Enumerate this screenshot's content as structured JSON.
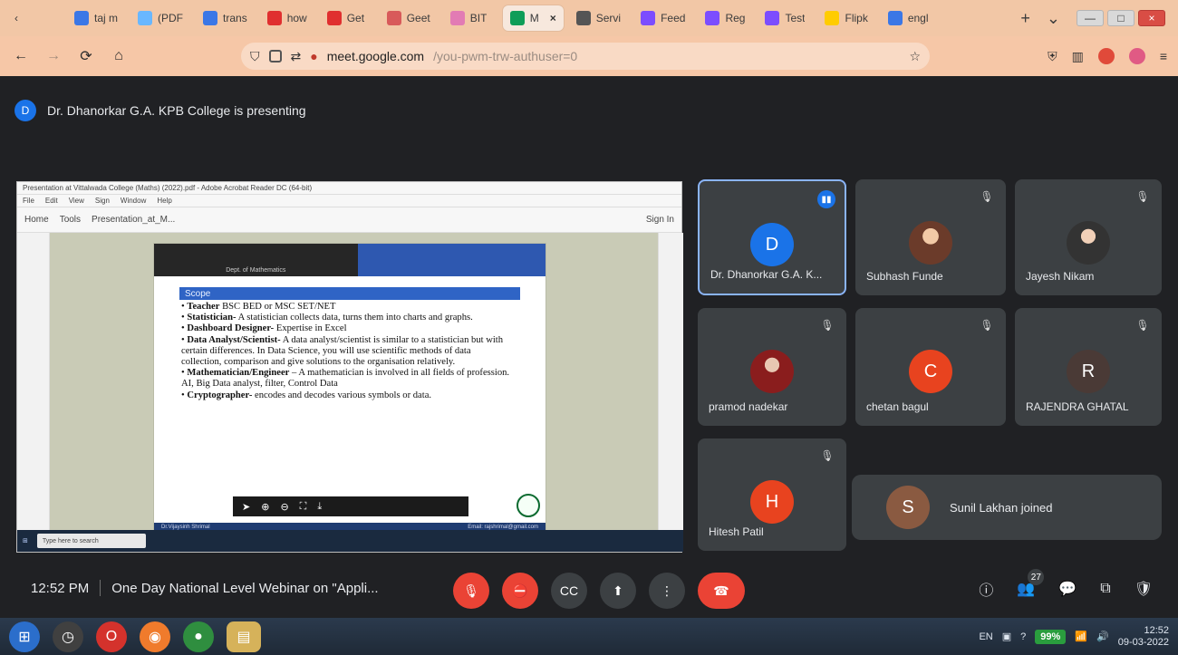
{
  "browser": {
    "tabs": [
      {
        "label": "taj m"
      },
      {
        "label": "(PDF"
      },
      {
        "label": "trans"
      },
      {
        "label": "how"
      },
      {
        "label": "Get"
      },
      {
        "label": "Geet"
      },
      {
        "label": "BIT"
      },
      {
        "label": "M",
        "active": true
      },
      {
        "label": "Servi"
      },
      {
        "label": "Feed"
      },
      {
        "label": "Reg"
      },
      {
        "label": "Test"
      },
      {
        "label": "Flipk"
      },
      {
        "label": "engl"
      }
    ],
    "url_domain": "meet.google.com",
    "url_rest": "/you-pwm-trw-authuser=0"
  },
  "meet": {
    "presenting_badge": "D",
    "presenting_text": "Dr. Dhanorkar G.A. KPB College is presenting",
    "shared_window": {
      "title_bar": "Presentation at Vittalwada College (Maths) (2022).pdf - Adobe Acrobat Reader DC (64-bit)",
      "menu": [
        "File",
        "Edit",
        "View",
        "Sign",
        "Window",
        "Help"
      ],
      "toolbar": [
        "Home",
        "Tools",
        "Presentation_at_M..."
      ],
      "signin": "Sign In",
      "slide": {
        "header_left": "Dept. of Mathematics",
        "scope_label": "Scope",
        "bullets": [
          {
            "bold": "Teacher",
            "rest": " BSC BED or MSC SET/NET"
          },
          {
            "bold": "Statistician-",
            "rest": " A statistician collects data, turns them into charts and graphs."
          },
          {
            "bold": "Dashboard Designer-",
            "rest": " Expertise in Excel"
          },
          {
            "bold": "Data Analyst/Scientist-",
            "rest": " A data analyst/scientist is similar to a statistician but with certain differences. In Data Science, you will use scientific methods of data collection, comparison and give solutions to the organisation relatively."
          },
          {
            "bold": "Mathematician/Engineer",
            "rest": " – A mathematician is involved in all fields of profession. AI, Big Data analyst, filter, Control Data"
          },
          {
            "bold": "Cryptographer-",
            "rest": " encodes and decodes various symbols or data."
          }
        ],
        "footer_left": "Dr.Vijaysinh Shrimal",
        "footer_right": "Email: rajshrimal@gmail.com"
      },
      "taskbar_search": "Type here to search"
    },
    "participants": [
      {
        "name": "Dr. Dhanorkar G.A. K...",
        "initial": "D",
        "avatar_color": "#1a73e8",
        "selected": true
      },
      {
        "name": "Subhash Funde",
        "initial": "",
        "avatar_kind": "photo"
      },
      {
        "name": "Jayesh Nikam",
        "initial": "",
        "avatar_kind": "photo3"
      },
      {
        "name": "pramod nadekar",
        "initial": "",
        "avatar_kind": "photo2"
      },
      {
        "name": "chetan bagul",
        "initial": "C",
        "avatar_color": "#e8431f"
      },
      {
        "name": "RAJENDRA GHATAL",
        "initial": "R",
        "avatar_color": "#4a3a36"
      },
      {
        "name": "Hitesh Patil",
        "initial": "H",
        "avatar_color": "#e8431f"
      }
    ],
    "toast": {
      "initial": "S",
      "text": "Sunil Lakhan joined"
    },
    "bottom": {
      "time": "12:52 PM",
      "meeting_title": "One Day National Level Webinar on \"Appli...",
      "people_count": "27"
    }
  },
  "windows": {
    "taskbar": {
      "lang": "EN",
      "battery": "99%",
      "time": "12:52",
      "date": "09-03-2022"
    }
  }
}
